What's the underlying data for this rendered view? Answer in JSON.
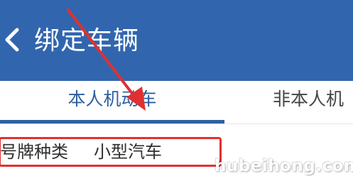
{
  "app_bar": {
    "back_icon": "chevron-left-icon",
    "title": "绑定车辆",
    "background_color": "#3166ae"
  },
  "tabs": [
    {
      "label": "本人机动车",
      "selected": true
    },
    {
      "label": "非本人机",
      "selected": false
    }
  ],
  "form": {
    "plate_type_label": "号牌种类",
    "plate_type_value": "小型汽车"
  },
  "annotation": {
    "arrow_color": "#e03030",
    "box_color": "#e03030"
  },
  "watermark": "hubeihong.com"
}
